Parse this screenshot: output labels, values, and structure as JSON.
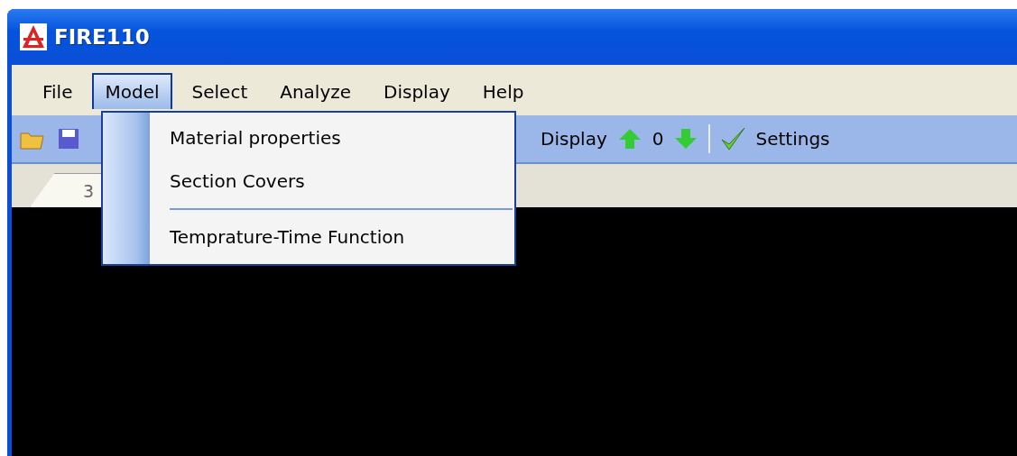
{
  "window": {
    "title": "FIRE110"
  },
  "menu_bar": [
    {
      "label": "File",
      "selected": false
    },
    {
      "label": "Model",
      "selected": true
    },
    {
      "label": "Select",
      "selected": false
    },
    {
      "label": "Analyze",
      "selected": false
    },
    {
      "label": "Display",
      "selected": false
    },
    {
      "label": "Help",
      "selected": false
    }
  ],
  "dropdown": [
    {
      "kind": "item",
      "label": "Material properties"
    },
    {
      "kind": "item",
      "label": "Section Covers"
    },
    {
      "kind": "separator"
    },
    {
      "kind": "item",
      "label": "Temprature-Time Function"
    }
  ],
  "toolbar": {
    "display_label": "Display",
    "counter": "0",
    "settings_label": "Settings"
  },
  "tabs": [
    {
      "label": "3",
      "selected": true
    }
  ]
}
